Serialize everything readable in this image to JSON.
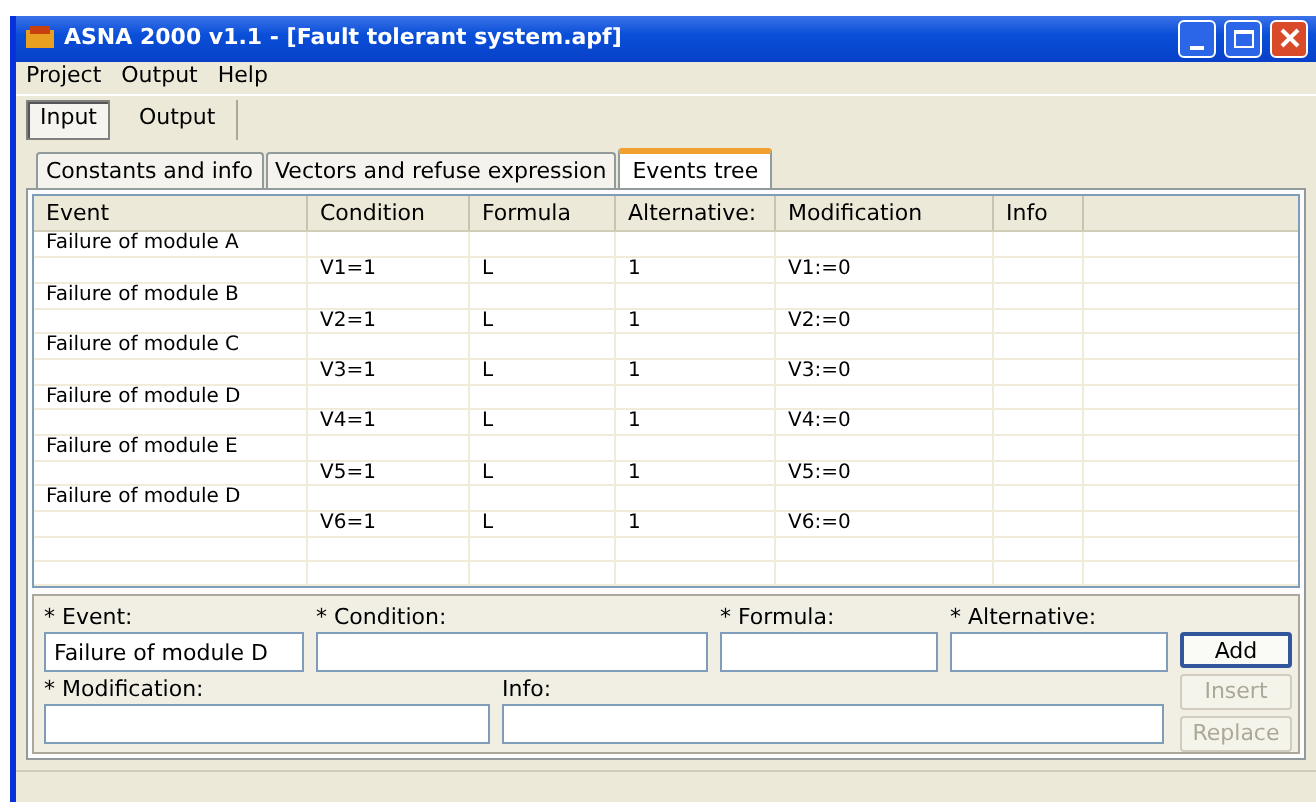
{
  "window": {
    "title": "ASNA 2000 v1.1 - [Fault tolerant system.apf]"
  },
  "menu": [
    "Project",
    "Output",
    "Help"
  ],
  "main_tabs": [
    {
      "label": "Input",
      "selected": true
    },
    {
      "label": "Output",
      "selected": false
    }
  ],
  "tabs": [
    {
      "label": "Constants and info",
      "selected": false
    },
    {
      "label": "Vectors and refuse expression",
      "selected": false
    },
    {
      "label": "Events tree",
      "selected": true
    }
  ],
  "table": {
    "columns": [
      "Event",
      "Condition",
      "Formula",
      "Alternative:",
      "Modification",
      "Info"
    ],
    "rows": [
      {
        "event": "Failure of module A"
      },
      {
        "condition": "V1=1",
        "formula": "L",
        "alternative": "1",
        "modification": "V1:=0"
      },
      {
        "event": "Failure of module B"
      },
      {
        "condition": "V2=1",
        "formula": "L",
        "alternative": "1",
        "modification": "V2:=0"
      },
      {
        "event": "Failure of module C"
      },
      {
        "condition": "V3=1",
        "formula": "L",
        "alternative": "1",
        "modification": "V3:=0"
      },
      {
        "event": "Failure of module D"
      },
      {
        "condition": "V4=1",
        "formula": "L",
        "alternative": "1",
        "modification": "V4:=0"
      },
      {
        "event": "Failure of module E"
      },
      {
        "condition": "V5=1",
        "formula": "L",
        "alternative": "1",
        "modification": "V5:=0"
      },
      {
        "event": "Failure of module D"
      },
      {
        "condition": "V6=1",
        "formula": "L",
        "alternative": "1",
        "modification": "V6:=0"
      }
    ]
  },
  "form": {
    "event": {
      "label": "* Event:",
      "value": "Failure of module D"
    },
    "condition": {
      "label": "* Condition:"
    },
    "formula": {
      "label": "* Formula:"
    },
    "alternative": {
      "label": "* Alternative:"
    },
    "modification": {
      "label": "* Modification:"
    },
    "info": {
      "label": "Info:"
    }
  },
  "buttons": [
    {
      "label": "Add",
      "disabled": false
    },
    {
      "label": "Insert",
      "disabled": true
    },
    {
      "label": "Replace",
      "disabled": true
    }
  ]
}
